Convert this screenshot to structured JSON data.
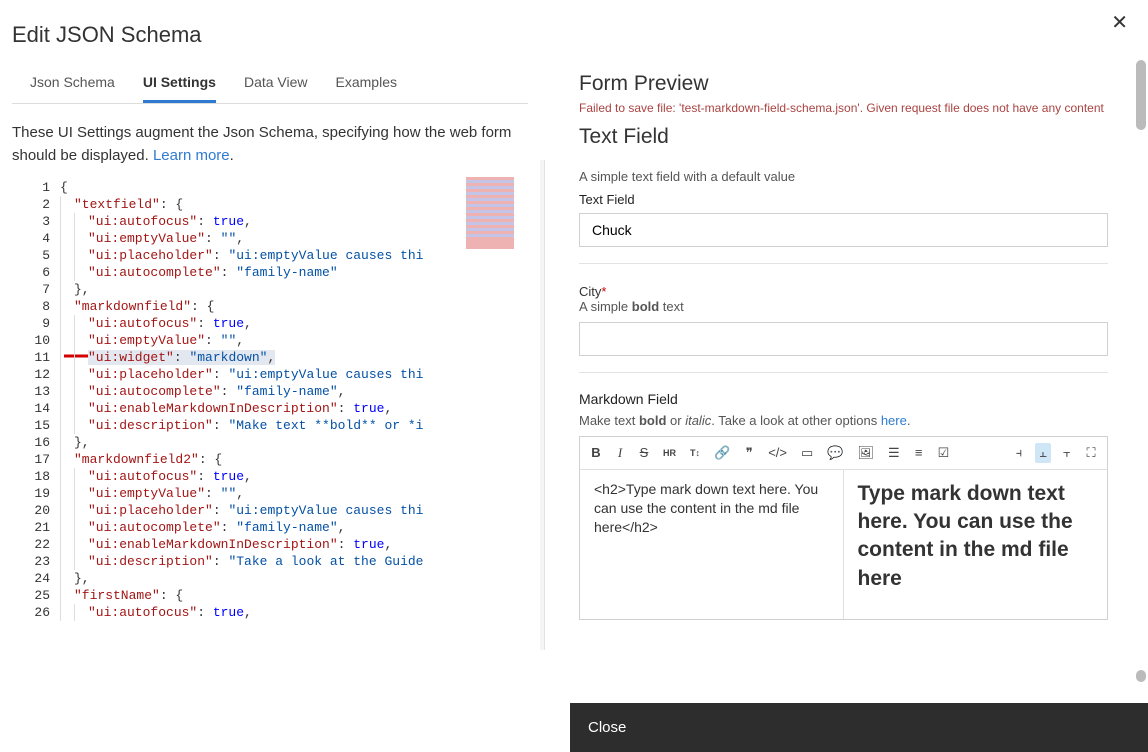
{
  "title": "Edit JSON Schema",
  "tabs": [
    "Json Schema",
    "UI Settings",
    "Data View",
    "Examples"
  ],
  "activeTab": 1,
  "help": {
    "text": "These UI Settings augment the Json Schema, specifying how the web form should be displayed. ",
    "learn": "Learn more"
  },
  "editor": {
    "lines": [
      {
        "n": 1,
        "seg": [
          {
            "t": "plain",
            "v": "{"
          }
        ]
      },
      {
        "n": 2,
        "indent": 1,
        "seg": [
          {
            "t": "k",
            "v": "\"textfield\""
          },
          {
            "t": "plain",
            "v": ": {"
          }
        ]
      },
      {
        "n": 3,
        "indent": 2,
        "seg": [
          {
            "t": "k",
            "v": "\"ui:autofocus\""
          },
          {
            "t": "plain",
            "v": ": "
          },
          {
            "t": "b",
            "v": "true"
          },
          {
            "t": "plain",
            "v": ","
          }
        ]
      },
      {
        "n": 4,
        "indent": 2,
        "seg": [
          {
            "t": "k",
            "v": "\"ui:emptyValue\""
          },
          {
            "t": "plain",
            "v": ": "
          },
          {
            "t": "v",
            "v": "\"\""
          },
          {
            "t": "plain",
            "v": ","
          }
        ]
      },
      {
        "n": 5,
        "indent": 2,
        "seg": [
          {
            "t": "k",
            "v": "\"ui:placeholder\""
          },
          {
            "t": "plain",
            "v": ": "
          },
          {
            "t": "v",
            "v": "\"ui:emptyValue causes thi"
          }
        ]
      },
      {
        "n": 6,
        "indent": 2,
        "seg": [
          {
            "t": "k",
            "v": "\"ui:autocomplete\""
          },
          {
            "t": "plain",
            "v": ": "
          },
          {
            "t": "v",
            "v": "\"family-name\""
          }
        ]
      },
      {
        "n": 7,
        "indent": 1,
        "seg": [
          {
            "t": "plain",
            "v": "},"
          }
        ]
      },
      {
        "n": 8,
        "indent": 1,
        "seg": [
          {
            "t": "k",
            "v": "\"markdownfield\""
          },
          {
            "t": "plain",
            "v": ": {"
          }
        ]
      },
      {
        "n": 9,
        "indent": 2,
        "seg": [
          {
            "t": "k",
            "v": "\"ui:autofocus\""
          },
          {
            "t": "plain",
            "v": ": "
          },
          {
            "t": "b",
            "v": "true"
          },
          {
            "t": "plain",
            "v": ","
          }
        ]
      },
      {
        "n": 10,
        "indent": 2,
        "seg": [
          {
            "t": "k",
            "v": "\"ui:emptyValue\""
          },
          {
            "t": "plain",
            "v": ": "
          },
          {
            "t": "v",
            "v": "\"\""
          },
          {
            "t": "plain",
            "v": ","
          }
        ]
      },
      {
        "n": 11,
        "indent": 2,
        "hl": true,
        "seg": [
          {
            "t": "k",
            "v": "\"ui:widget\""
          },
          {
            "t": "plain",
            "v": ": "
          },
          {
            "t": "v",
            "v": "\"markdown\""
          },
          {
            "t": "plain",
            "v": ","
          }
        ]
      },
      {
        "n": 12,
        "indent": 2,
        "seg": [
          {
            "t": "k",
            "v": "\"ui:placeholder\""
          },
          {
            "t": "plain",
            "v": ": "
          },
          {
            "t": "v",
            "v": "\"ui:emptyValue causes thi"
          }
        ]
      },
      {
        "n": 13,
        "indent": 2,
        "seg": [
          {
            "t": "k",
            "v": "\"ui:autocomplete\""
          },
          {
            "t": "plain",
            "v": ": "
          },
          {
            "t": "v",
            "v": "\"family-name\""
          },
          {
            "t": "plain",
            "v": ","
          }
        ]
      },
      {
        "n": 14,
        "indent": 2,
        "seg": [
          {
            "t": "k",
            "v": "\"ui:enableMarkdownInDescription\""
          },
          {
            "t": "plain",
            "v": ": "
          },
          {
            "t": "b",
            "v": "true"
          },
          {
            "t": "plain",
            "v": ","
          }
        ]
      },
      {
        "n": 15,
        "indent": 2,
        "seg": [
          {
            "t": "k",
            "v": "\"ui:description\""
          },
          {
            "t": "plain",
            "v": ": "
          },
          {
            "t": "v",
            "v": "\"Make text **bold** or *i"
          }
        ]
      },
      {
        "n": 16,
        "indent": 1,
        "seg": [
          {
            "t": "plain",
            "v": "},"
          }
        ]
      },
      {
        "n": 17,
        "indent": 1,
        "seg": [
          {
            "t": "k",
            "v": "\"markdownfield2\""
          },
          {
            "t": "plain",
            "v": ": {"
          }
        ]
      },
      {
        "n": 18,
        "indent": 2,
        "seg": [
          {
            "t": "k",
            "v": "\"ui:autofocus\""
          },
          {
            "t": "plain",
            "v": ": "
          },
          {
            "t": "b",
            "v": "true"
          },
          {
            "t": "plain",
            "v": ","
          }
        ]
      },
      {
        "n": 19,
        "indent": 2,
        "seg": [
          {
            "t": "k",
            "v": "\"ui:emptyValue\""
          },
          {
            "t": "plain",
            "v": ": "
          },
          {
            "t": "v",
            "v": "\"\""
          },
          {
            "t": "plain",
            "v": ","
          }
        ]
      },
      {
        "n": 20,
        "indent": 2,
        "seg": [
          {
            "t": "k",
            "v": "\"ui:placeholder\""
          },
          {
            "t": "plain",
            "v": ": "
          },
          {
            "t": "v",
            "v": "\"ui:emptyValue causes thi"
          }
        ]
      },
      {
        "n": 21,
        "indent": 2,
        "seg": [
          {
            "t": "k",
            "v": "\"ui:autocomplete\""
          },
          {
            "t": "plain",
            "v": ": "
          },
          {
            "t": "v",
            "v": "\"family-name\""
          },
          {
            "t": "plain",
            "v": ","
          }
        ]
      },
      {
        "n": 22,
        "indent": 2,
        "seg": [
          {
            "t": "k",
            "v": "\"ui:enableMarkdownInDescription\""
          },
          {
            "t": "plain",
            "v": ": "
          },
          {
            "t": "b",
            "v": "true"
          },
          {
            "t": "plain",
            "v": ","
          }
        ]
      },
      {
        "n": 23,
        "indent": 2,
        "seg": [
          {
            "t": "k",
            "v": "\"ui:description\""
          },
          {
            "t": "plain",
            "v": ": "
          },
          {
            "t": "v",
            "v": "\"Take a look at the Guide"
          }
        ]
      },
      {
        "n": 24,
        "indent": 1,
        "seg": [
          {
            "t": "plain",
            "v": "},"
          }
        ]
      },
      {
        "n": 25,
        "indent": 1,
        "seg": [
          {
            "t": "k",
            "v": "\"firstName\""
          },
          {
            "t": "plain",
            "v": ": {"
          }
        ]
      },
      {
        "n": 26,
        "indent": 2,
        "seg": [
          {
            "t": "k",
            "v": "\"ui:autofocus\""
          },
          {
            "t": "plain",
            "v": ": "
          },
          {
            "t": "b",
            "v": "true"
          },
          {
            "t": "plain",
            "v": ","
          }
        ]
      }
    ]
  },
  "form": {
    "preview_title": "Form Preview",
    "error": "Failed to save file: 'test-markdown-field-schema.json'. Given request file does not have any content",
    "header": "Text Field",
    "text_field": {
      "subtitle": "A simple text field with a default value",
      "label": "Text Field",
      "value": "Chuck"
    },
    "city": {
      "label": "City",
      "sub_a": "A simple ",
      "sub_bold": "bold",
      "sub_b": " text",
      "value": ""
    },
    "md": {
      "label": "Markdown Field",
      "sub_a": "Make text ",
      "sub_bold": "bold",
      "sub_or": " or ",
      "sub_italic": "italic",
      "sub_b": ". Take a look at other options ",
      "sub_link": "here",
      "sub_dot": ".",
      "src": "<h2>Type mark down text here. You can use the content in the md file here</h2>",
      "preview": "Type mark down text here. You can use the content in the md file here"
    }
  },
  "footer": {
    "close": "Close"
  }
}
